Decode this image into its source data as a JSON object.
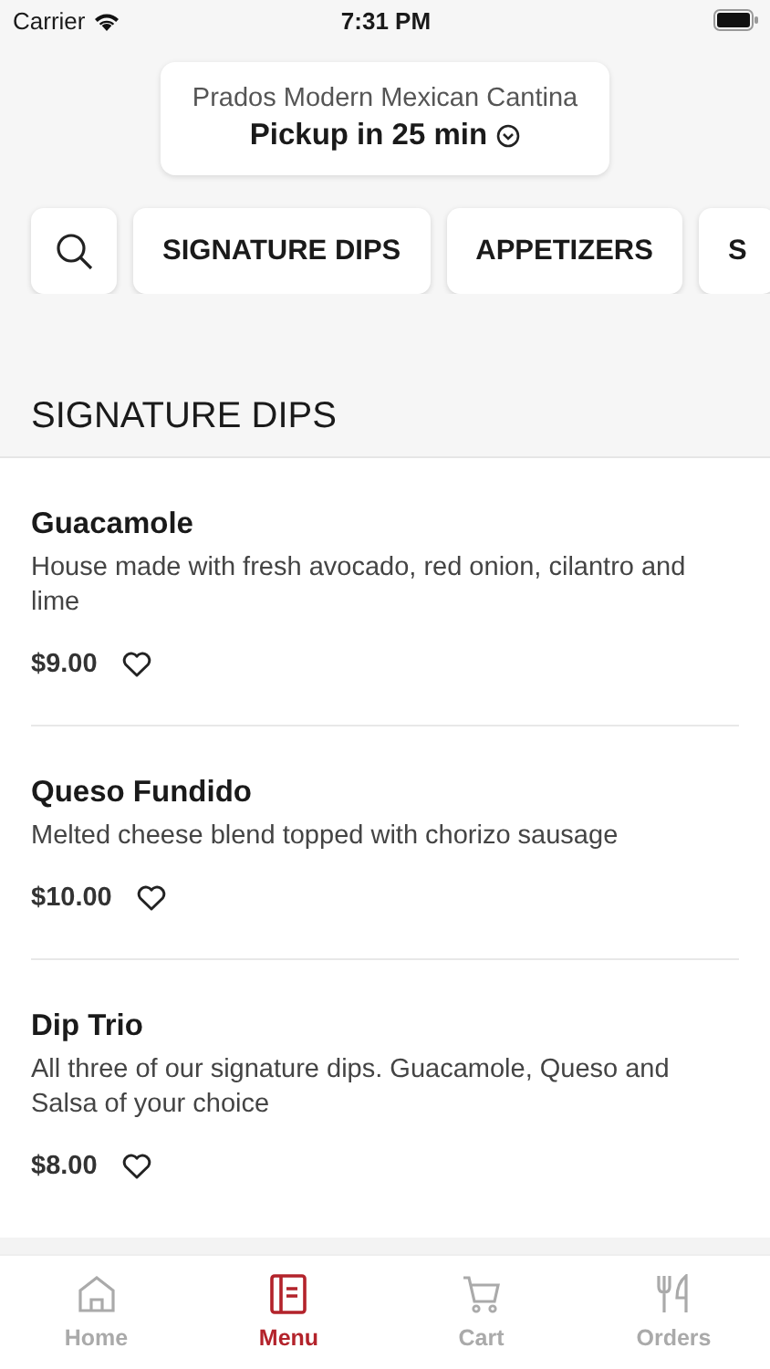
{
  "status_bar": {
    "carrier": "Carrier",
    "time": "7:31 PM"
  },
  "header": {
    "restaurant": "Prados Modern Mexican Cantina",
    "pickup": "Pickup in 25 min"
  },
  "categories": [
    {
      "label": "SIGNATURE DIPS",
      "selected": false
    },
    {
      "label": "APPETIZERS",
      "selected": false
    },
    {
      "label": "S",
      "selected": false
    }
  ],
  "section": {
    "title": "SIGNATURE DIPS"
  },
  "items": [
    {
      "name": "Guacamole",
      "description": "House made with fresh avocado, red onion, cilantro and lime",
      "price": "$9.00",
      "favorite": false
    },
    {
      "name": "Queso Fundido",
      "description": "Melted cheese blend topped with chorizo sausage",
      "price": "$10.00",
      "favorite": false
    },
    {
      "name": "Dip Trio",
      "description": "All three of our signature dips. Guacamole, Queso and Salsa of your choice",
      "price": "$8.00",
      "favorite": false
    }
  ],
  "tab_bar": [
    {
      "kind": "home",
      "label": "Home",
      "selected": false
    },
    {
      "kind": "menu",
      "label": "Menu",
      "selected": true
    },
    {
      "kind": "cart",
      "label": "Cart",
      "selected": false
    },
    {
      "kind": "orders",
      "label": "Orders",
      "selected": false
    }
  ]
}
